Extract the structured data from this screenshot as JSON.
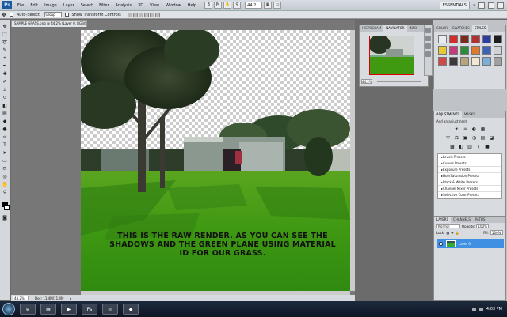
{
  "app": {
    "menu": [
      "File",
      "Edit",
      "Image",
      "Layer",
      "Select",
      "Filter",
      "Analysis",
      "3D",
      "View",
      "Window",
      "Help"
    ],
    "logo": "Ps",
    "zoom": "44.2",
    "workspace": "ESSENTIALS"
  },
  "options": {
    "auto_select_label": "Auto-Select:",
    "auto_select_value": "Group",
    "show_transform_label": "Show Transform Controls"
  },
  "document": {
    "tab_title": "SAMPLE GRASS.png @ 44.2% (Layer 0, RGB/8)",
    "caption_line1": "THIS IS THE RAW RENDER. AS YOU CAN SEE THE",
    "caption_line2": "SHADOWS AND THE GREEN PLANE USING MATERIAL",
    "caption_line3": "ID FOR OUR GRASS.",
    "status_zoom": "44.2%",
    "status_doc": "Doc: 11.4M/11.4M"
  },
  "navigator": {
    "tabs": [
      "HISTOGRAM",
      "NAVIGATOR",
      "INFO"
    ],
    "zoom": "44.2%"
  },
  "styles": {
    "tabs": [
      "COLOR",
      "SWATCHES",
      "STYLES"
    ],
    "swatches": [
      "#e9ecef",
      "#d42b2b",
      "#7b2b1b",
      "#b23030",
      "#2c3ea0",
      "#1d1d1d",
      "#e8c832",
      "#c43a7a",
      "#2f8a3a",
      "#e07a2a",
      "#3a62b8",
      "#cfd3d8",
      "#d04848",
      "#3a3a3a",
      "#b8a47a",
      "#f0e8d0",
      "#7ab0d8",
      "#a0a0a0"
    ]
  },
  "adjustments": {
    "tabs": [
      "ADJUSTMENTS",
      "MASKS"
    ],
    "label": "Add an adjustment",
    "icons_row1": [
      "☀",
      "≡",
      "◐",
      "▦"
    ],
    "icons_row2": [
      "▽",
      "⚖",
      "▣",
      "◑",
      "▤",
      "◪"
    ],
    "icons_row3": [
      "▩",
      "◧",
      "▥",
      "∖",
      "■"
    ],
    "presets": [
      "Levels Presets",
      "Curves Presets",
      "Exposure Presets",
      "Hue/Saturation Presets",
      "Black & White Presets",
      "Channel Mixer Presets",
      "Selective Color Presets"
    ]
  },
  "layers": {
    "tabs": [
      "LAYERS",
      "CHANNELS",
      "PATHS"
    ],
    "blend_mode": "Normal",
    "opacity_label": "Opacity:",
    "opacity_value": "100%",
    "lock_label": "Lock:",
    "fill_label": "Fill:",
    "fill_value": "100%",
    "layer_name": "Layer 0"
  },
  "taskbar": {
    "time": "4:03 PM"
  }
}
